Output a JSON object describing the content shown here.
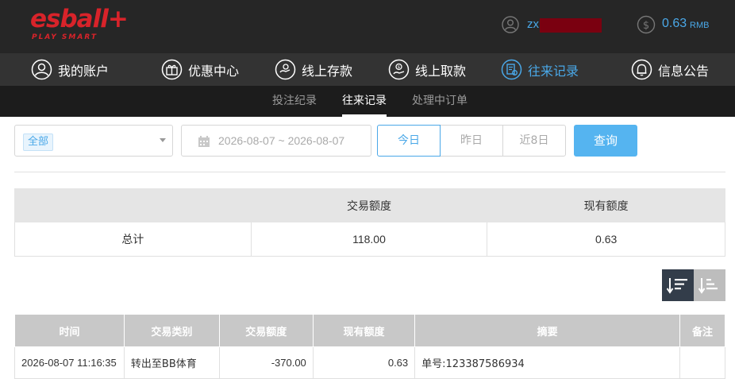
{
  "brand": {
    "name": "esball+",
    "tagline": "PLAY SMART",
    "color": "#d8232a"
  },
  "header": {
    "username": "zx",
    "balance": "0.63",
    "currency": "RMB"
  },
  "main_nav": [
    {
      "label": "我的账户",
      "icon": "user-icon"
    },
    {
      "label": "优惠中心",
      "icon": "gift-icon"
    },
    {
      "label": "线上存款",
      "icon": "deposit-icon"
    },
    {
      "label": "线上取款",
      "icon": "withdraw-icon"
    },
    {
      "label": "往来记录",
      "icon": "records-icon",
      "active": true
    },
    {
      "label": "信息公告",
      "icon": "bell-icon"
    }
  ],
  "sub_nav": [
    {
      "label": "投注纪录"
    },
    {
      "label": "往来记录",
      "active": true
    },
    {
      "label": "处理中订单"
    }
  ],
  "filter": {
    "type_selected": "全部",
    "date_range": "2026-08-07 ~ 2026-08-07",
    "ranges": [
      "今日",
      "昨日",
      "近8日"
    ],
    "active_range": "今日",
    "query_label": "查询"
  },
  "summary": {
    "headers": [
      "",
      "交易额度",
      "现有额度"
    ],
    "row": {
      "label": "总计",
      "amount": "118.00",
      "balance": "0.63"
    }
  },
  "records": {
    "headers": [
      "时间",
      "交易类别",
      "交易额度",
      "现有额度",
      "摘要",
      "备注"
    ],
    "rows": [
      {
        "time": "2026-08-07 11:16:35",
        "type": "转出至BB体育",
        "amount": "-370.00",
        "balance": "0.63",
        "summary": "单号:123387586934",
        "note": ""
      }
    ]
  },
  "colors": {
    "accent": "#4aa8e8",
    "topbar": "#262626",
    "nav": "#333333"
  }
}
